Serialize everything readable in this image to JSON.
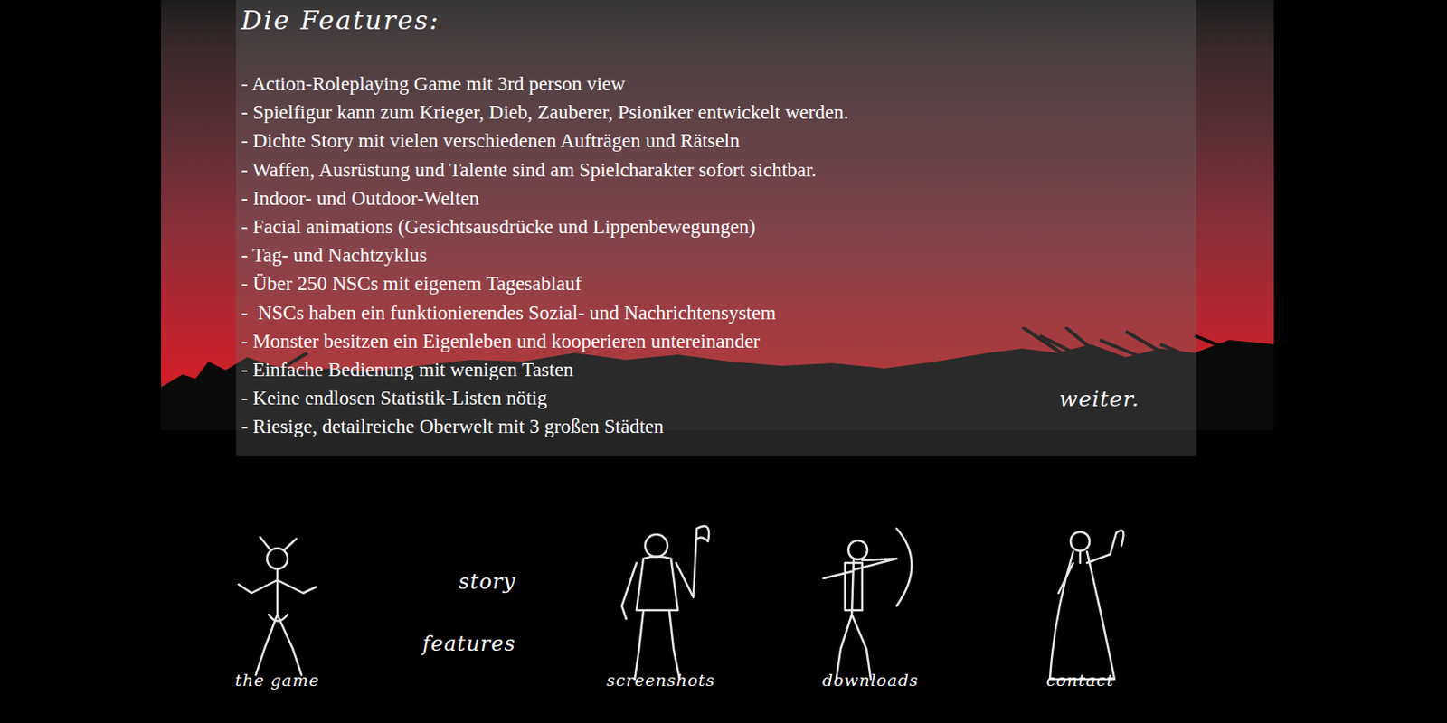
{
  "page": {
    "title": "Die Features:",
    "features": [
      "- Action-Roleplaying Game mit 3rd person view",
      "- Spielfigur kann zum Krieger, Dieb, Zauberer, Psioniker entwickelt werden.",
      "- Dichte Story mit vielen verschiedenen Aufträgen und Rätseln",
      "- Waffen, Ausrüstung und Talente sind am Spielcharakter sofort sichtbar.",
      "- Indoor- und Outdoor-Welten",
      "- Facial animations (Gesichtsausdrücke und Lippenbewegungen)",
      "- Tag- und Nachtzyklus",
      "- Über 250 NSCs mit eigenem Tagesablauf",
      "-  NSCs haben ein funktionierendes Sozial- und Nachrichtensystem",
      "- Monster besitzen ein Eigenleben und kooperieren untereinander",
      "- Einfache Bedienung mit wenigen Tasten",
      "- Keine endlosen Statistik-Listen nötig",
      "- Riesige, detailreiche Oberwelt mit 3 großen Städten"
    ],
    "next_link": "weiter."
  },
  "nav": {
    "figures": [
      {
        "label": "the game"
      },
      {
        "label": "screenshots"
      },
      {
        "label": "downloads"
      },
      {
        "label": "contact"
      }
    ],
    "links": [
      "story",
      "features"
    ]
  }
}
